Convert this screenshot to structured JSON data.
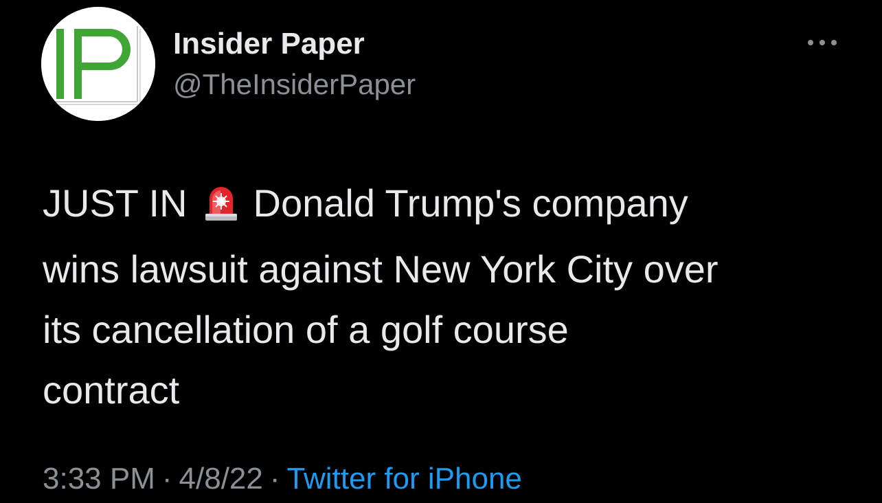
{
  "author": {
    "avatar_text": "IP",
    "name": "Insider Paper",
    "handle": "@TheInsiderPaper"
  },
  "more_icon": "more-horizontal-icon",
  "tweet": {
    "line1_prefix": "JUST IN",
    "emoji": "police-car-light-icon",
    "line1_suffix": "Donald Trump's company",
    "line2": "wins lawsuit against New York City over",
    "line3": "its cancellation of a golf course",
    "line4": "contract"
  },
  "meta": {
    "time": "3:33 PM",
    "separator": "·",
    "date": "4/8/22",
    "source": "Twitter for iPhone"
  },
  "colors": {
    "background": "#000000",
    "text": "#e7e9ea",
    "secondary": "#8b9096",
    "link": "#1d9bf0",
    "avatar_logo": "#3fa535"
  }
}
